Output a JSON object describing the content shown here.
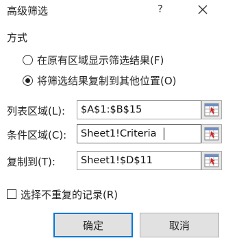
{
  "window": {
    "title": "高级筛选",
    "help_label": "?"
  },
  "mode": {
    "section_label": "方式",
    "options": [
      {
        "label": "在原有区域显示筛选结果(F)",
        "checked": false
      },
      {
        "label": "将筛选结果复制到其他位置(O)",
        "checked": true
      }
    ]
  },
  "fields": {
    "list_range": {
      "label": "列表区域(L):",
      "value": "$A$1:$B$15"
    },
    "criteria_range": {
      "label": "条件区域(C):",
      "value": "Sheet1!Criteria"
    },
    "copy_to": {
      "label": "复制到(T):",
      "value": "Sheet1!$D$11"
    }
  },
  "unique_records": {
    "label": "选择不重复的记录(R)",
    "checked": false
  },
  "buttons": {
    "ok_label": "确定",
    "cancel_label": "取消"
  },
  "colors": {
    "default_button_border": "#0078d7",
    "button_face": "#e1e1e1"
  },
  "icons": {
    "close": "close-icon",
    "range_select": "range-select-icon"
  }
}
